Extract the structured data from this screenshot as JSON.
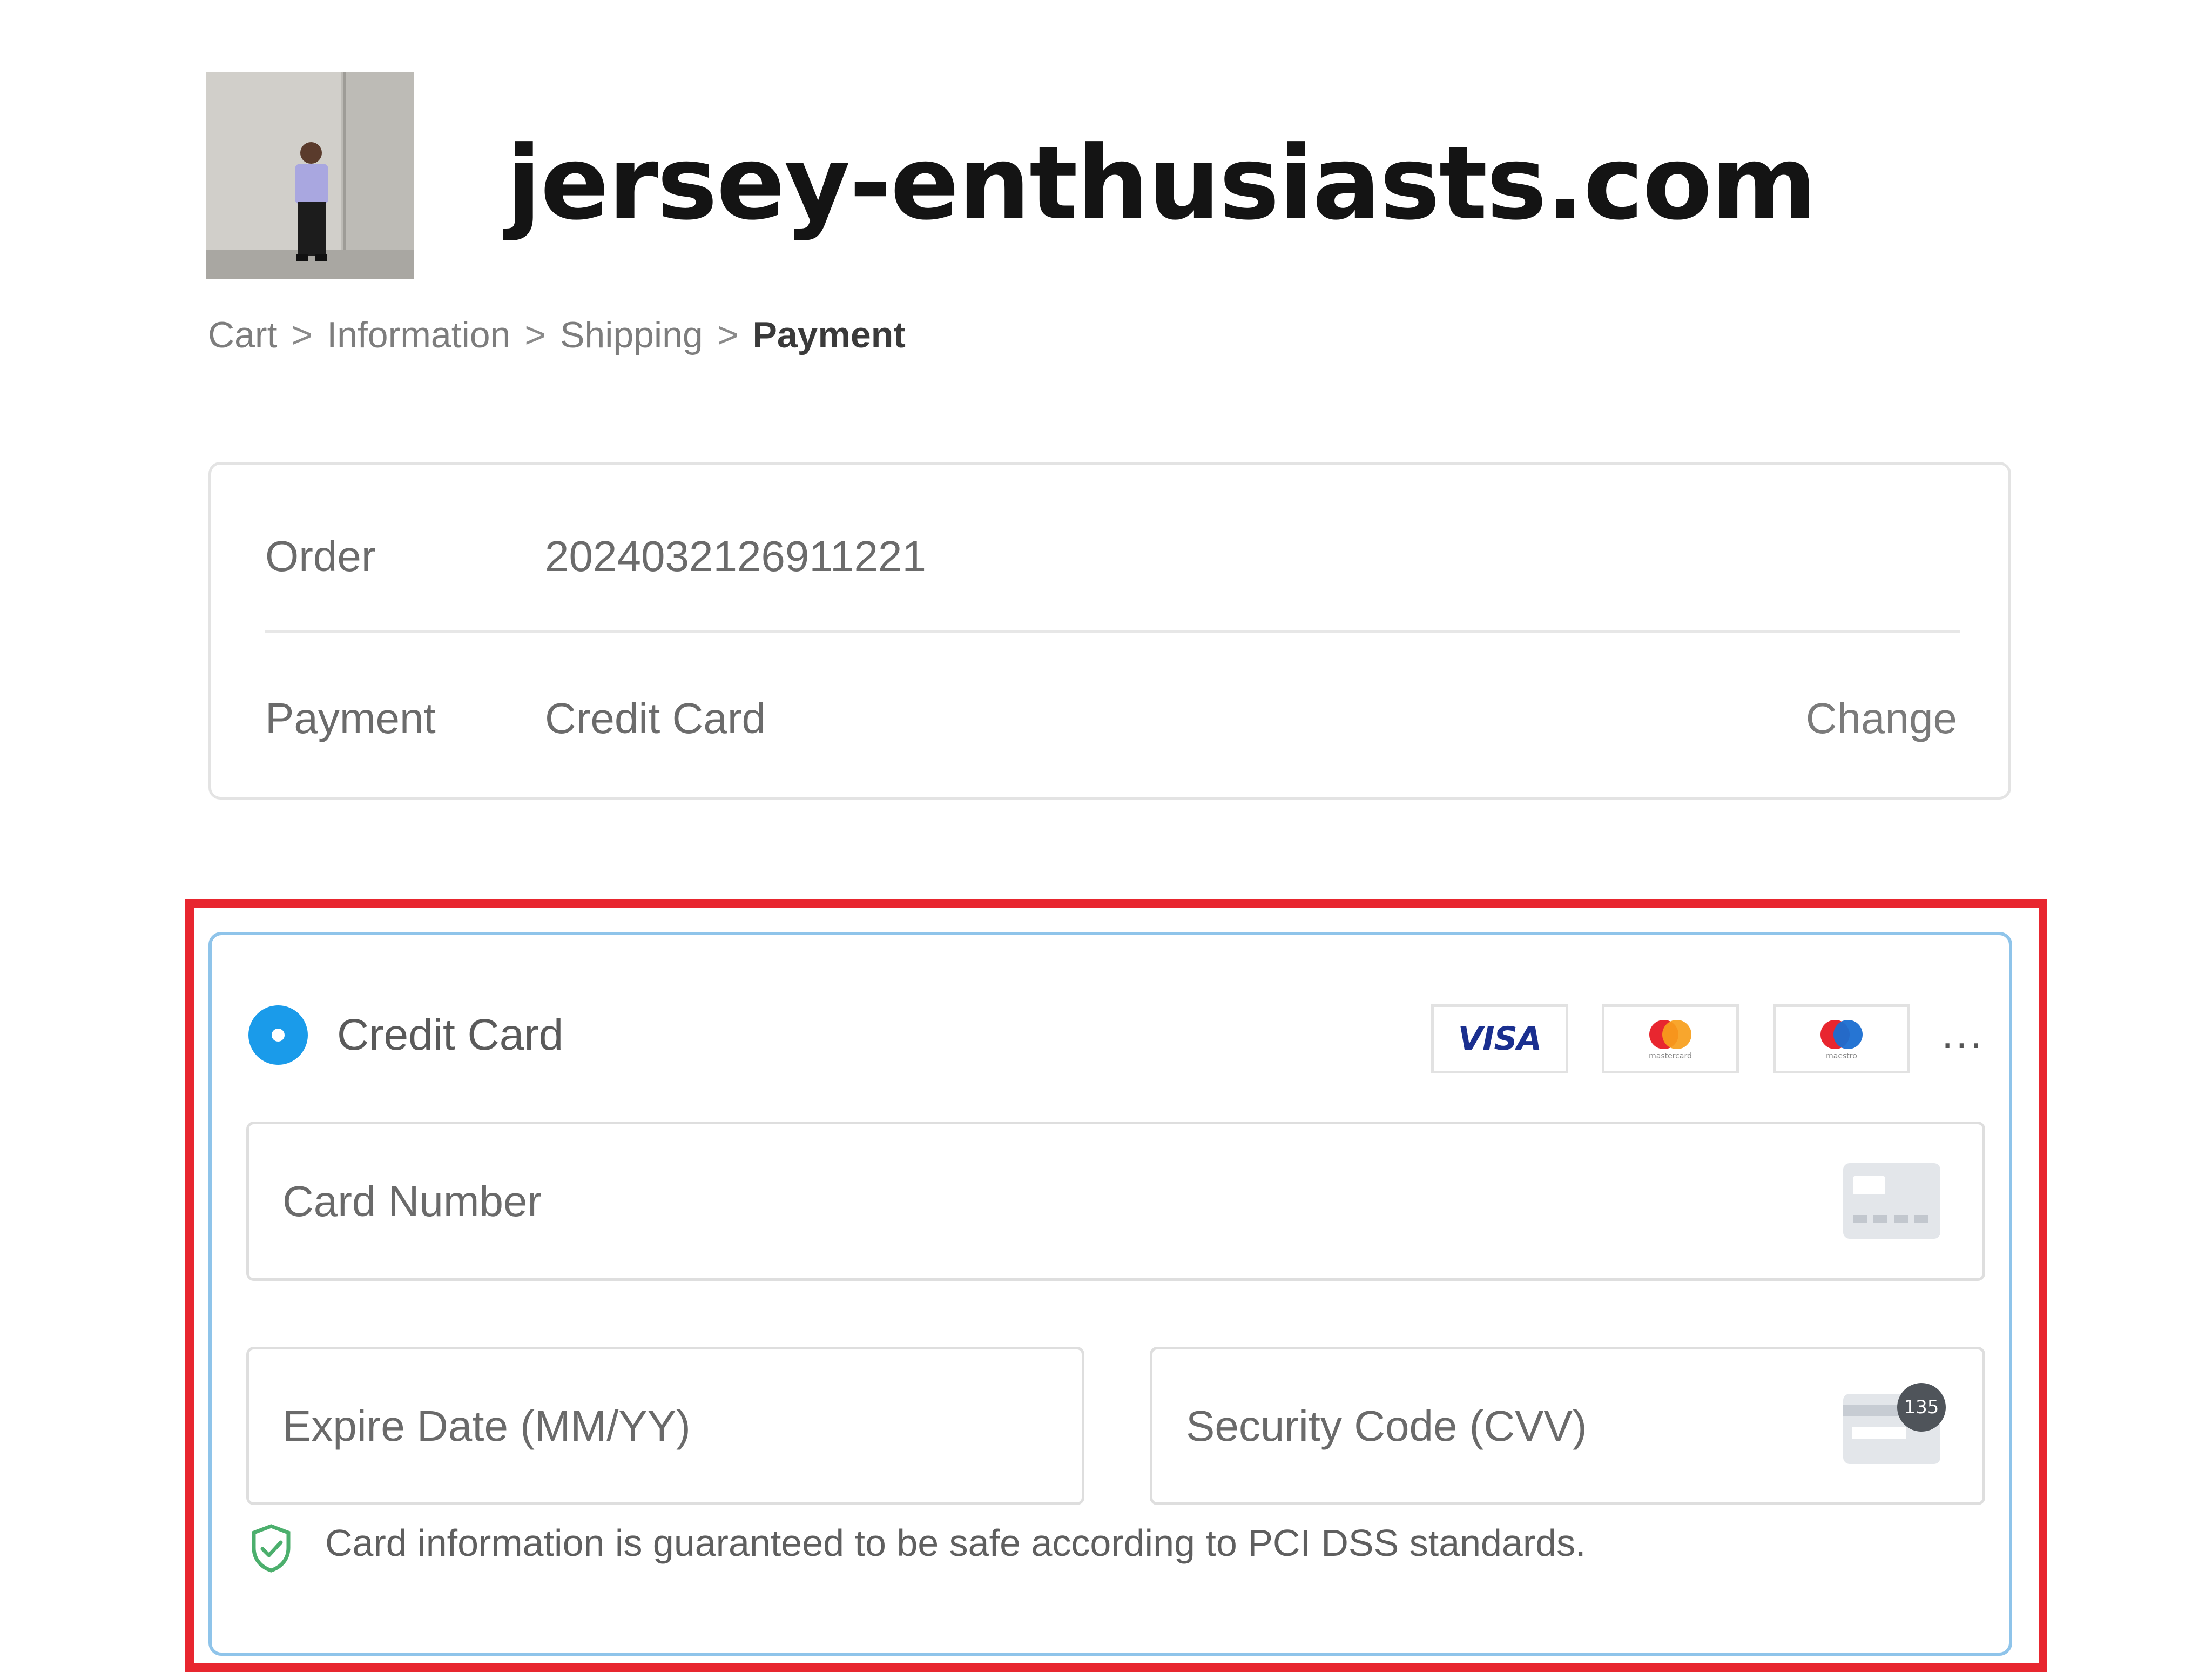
{
  "header": {
    "site_title": "jersey-enthusiasts.com"
  },
  "breadcrumb": {
    "items": [
      "Cart",
      "Information",
      "Shipping",
      "Payment"
    ],
    "separator": ">"
  },
  "summary": {
    "order_label": "Order",
    "order_value": "2024032126911221",
    "payment_label": "Payment",
    "payment_value": "Credit Card",
    "change_label": "Change"
  },
  "payment_method": {
    "label": "Credit Card",
    "selected": true,
    "brands": [
      {
        "name": "visa",
        "text": "VISA"
      },
      {
        "name": "mastercard",
        "text": "mastercard"
      },
      {
        "name": "maestro",
        "text": "maestro"
      }
    ],
    "more_label": "...",
    "card_number_placeholder": "Card Number",
    "expiry_placeholder": "Expire Date (MM/YY)",
    "cvv_placeholder": "Security Code (CVV)",
    "cvv_icon_text": "135",
    "security_note": "Card information is guaranteed to be safe according to PCI DSS standards."
  },
  "colors": {
    "accent_blue": "#1a9bea",
    "panel_border": "#8fc4ea",
    "highlight_red": "#e8262f",
    "shield_green": "#4caf6d"
  }
}
